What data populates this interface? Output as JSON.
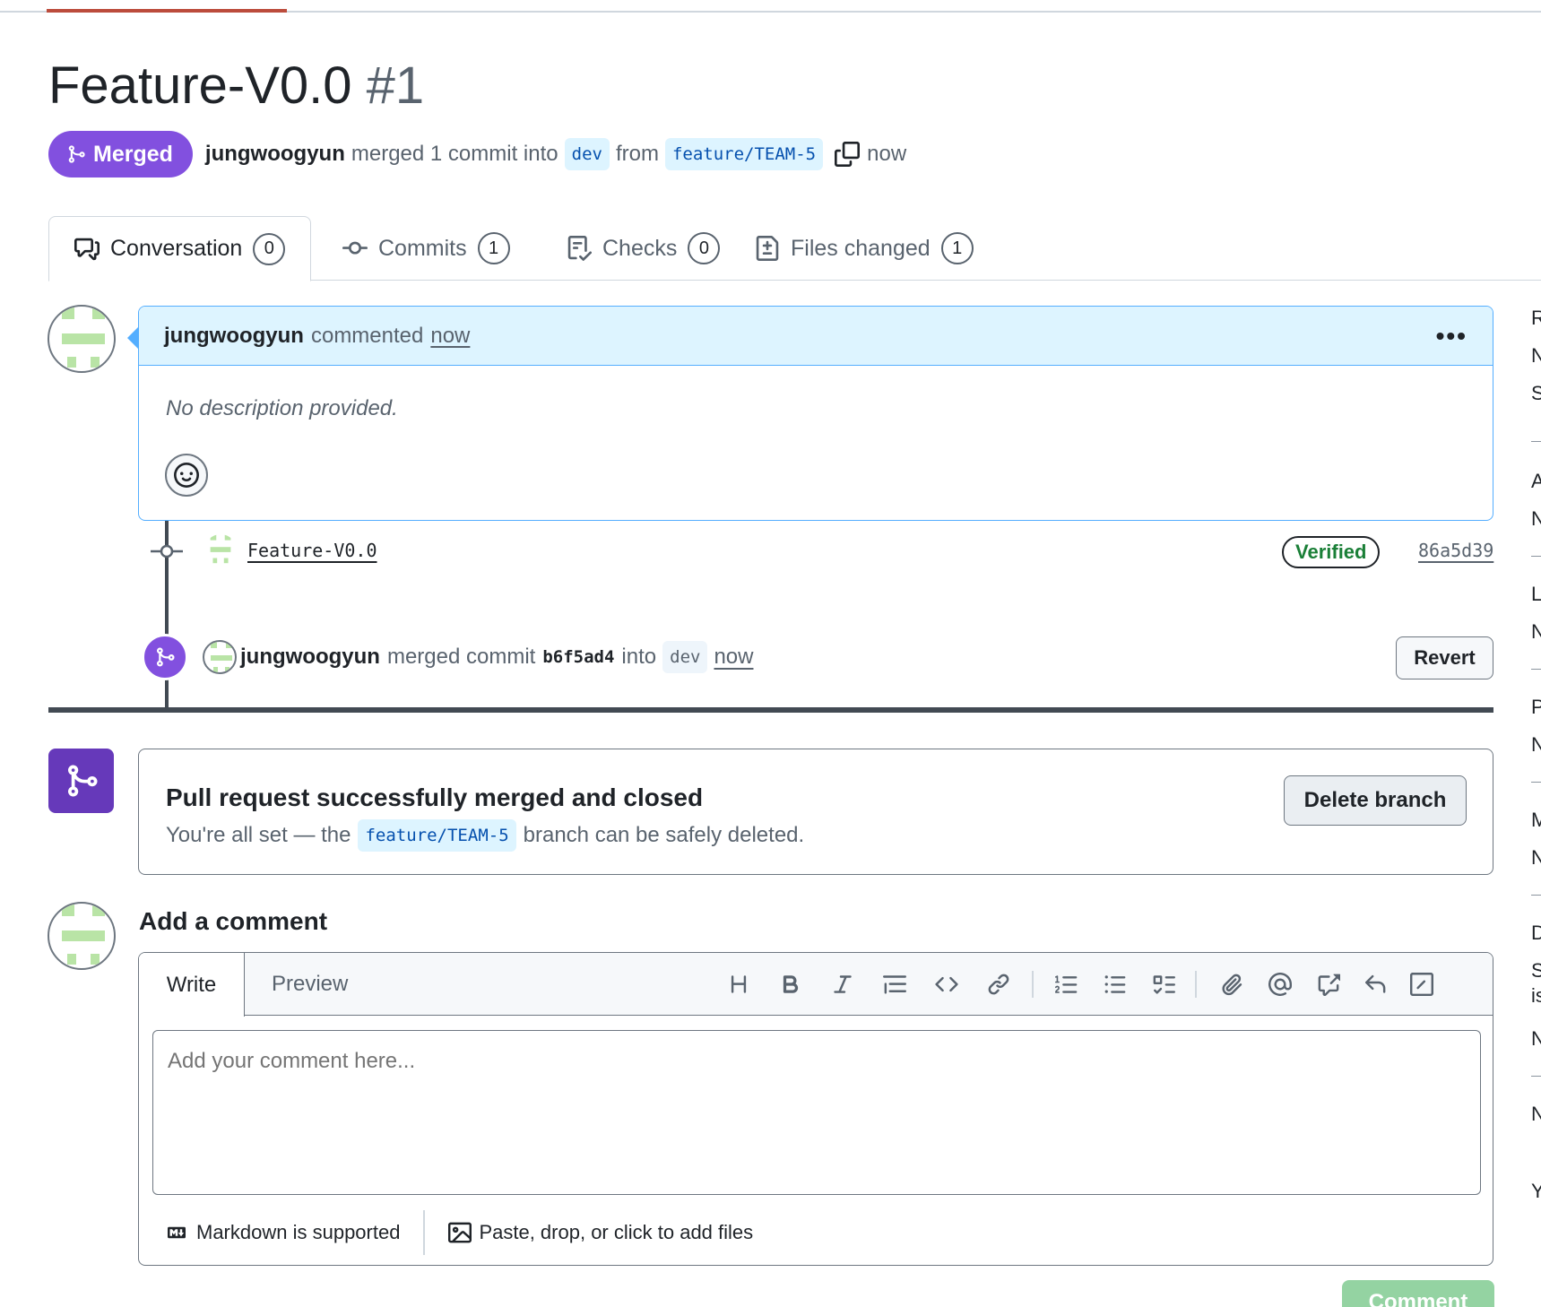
{
  "page": {
    "title": "Feature-V0.0",
    "number": "#1"
  },
  "header": {
    "state_label": "Merged",
    "author": "jungwoogyun",
    "summary": "merged 1 commit into",
    "base_branch": "dev",
    "from_label": "from",
    "head_branch": "feature/TEAM-5",
    "time": "now"
  },
  "tabs": [
    {
      "label": "Conversation",
      "count": "0"
    },
    {
      "label": "Commits",
      "count": "1"
    },
    {
      "label": "Checks",
      "count": "0"
    },
    {
      "label": "Files changed",
      "count": "1"
    }
  ],
  "comment": {
    "author": "jungwoogyun",
    "action": "commented",
    "time": "now",
    "body": "No description provided."
  },
  "commit": {
    "message": "Feature-V0.0",
    "verified_label": "Verified",
    "sha": "86a5d39"
  },
  "merge_event": {
    "author": "jungwoogyun",
    "action": "merged commit",
    "sha": "b6f5ad4",
    "into_label": "into",
    "branch": "dev",
    "time": "now",
    "revert_label": "Revert"
  },
  "merged_box": {
    "title": "Pull request successfully merged and closed",
    "sub_prefix": "You're all set — the",
    "branch": "feature/TEAM-5",
    "sub_suffix": "branch can be safely deleted.",
    "delete_label": "Delete branch"
  },
  "add_comment": {
    "title": "Add a comment",
    "write_tab": "Write",
    "preview_tab": "Preview",
    "placeholder": "Add your comment here...",
    "markdown_note": "Markdown is supported",
    "files_note": "Paste, drop, or click to add files",
    "submit_label": "Comment"
  },
  "sidebar_peek": [
    "R",
    "N",
    "S",
    "A",
    "N",
    "L",
    "N",
    "P",
    "N",
    "M",
    "N",
    "D",
    "S",
    "is",
    "N",
    "N",
    "Y"
  ],
  "colors": {
    "merged_purple": "#8250df",
    "merged_dark_purple": "#6639ba",
    "verified_green": "#1a7f37",
    "link_blue": "#0550ae",
    "comment_header_bg": "#ddf4ff",
    "comment_button_disabled": "#94d3a2"
  },
  "icons": {
    "merged": "git-merge-icon",
    "copy": "copy-icon",
    "conversation": "comment-discussion-icon",
    "commits": "git-commit-icon",
    "checks": "checklist-icon",
    "files": "file-diff-icon",
    "kebab": "kebab-horizontal-icon",
    "emoji": "smiley-icon"
  }
}
